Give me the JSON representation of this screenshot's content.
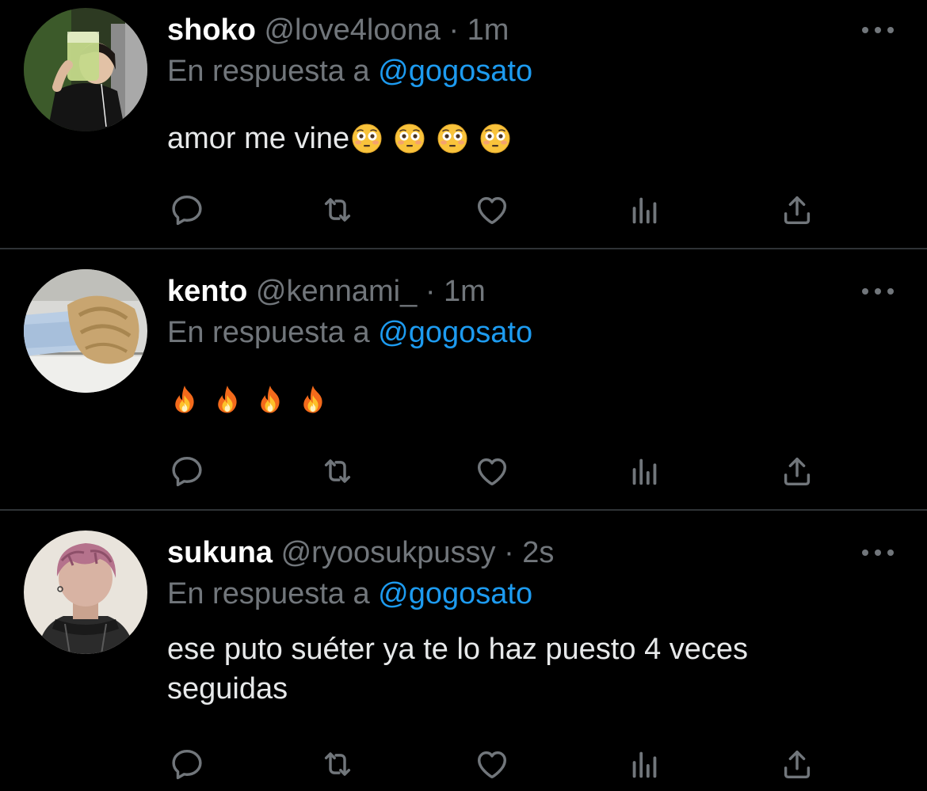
{
  "colors": {
    "background": "#000000",
    "divider": "#2f3336",
    "muted": "#71767b",
    "link": "#1d9bf0",
    "text": "#e7e9ea"
  },
  "tweets": [
    {
      "name": "shoko",
      "handle": "@love4loona",
      "separator": "·",
      "time": "1m",
      "reply_prefix": "En respuesta a",
      "reply_to": "@gogosato",
      "text": "amor me vine",
      "emojis": [
        "flushed-face",
        "flushed-face",
        "flushed-face",
        "flushed-face"
      ],
      "icons": [
        "reply-icon",
        "retweet-icon",
        "like-icon",
        "views-icon",
        "share-icon"
      ]
    },
    {
      "name": "kento",
      "handle": "@kennami_",
      "separator": "·",
      "time": "1m",
      "reply_prefix": "En respuesta a",
      "reply_to": "@gogosato",
      "text": "",
      "emojis": [
        "fire",
        "fire",
        "fire",
        "fire"
      ],
      "icons": [
        "reply-icon",
        "retweet-icon",
        "like-icon",
        "views-icon",
        "share-icon"
      ]
    },
    {
      "name": "sukuna",
      "handle": "@ryoosukpussy",
      "separator": "·",
      "time": "2s",
      "reply_prefix": "En respuesta a",
      "reply_to": "@gogosato",
      "text": "ese puto suéter ya te lo haz puesto 4 veces seguidas",
      "emojis": [],
      "icons": [
        "reply-icon",
        "retweet-icon",
        "like-icon",
        "views-icon",
        "share-icon"
      ]
    }
  ]
}
